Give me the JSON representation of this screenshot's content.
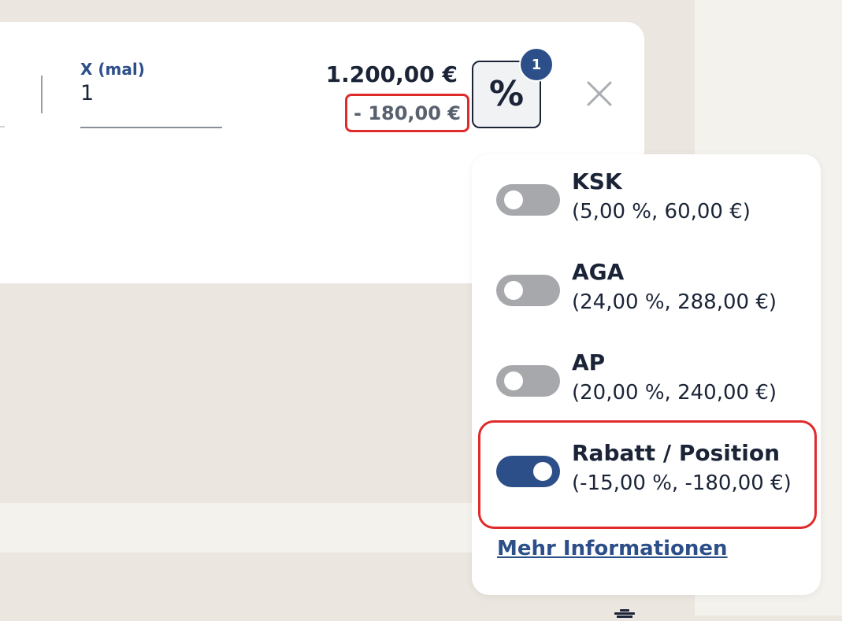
{
  "position_row": {
    "quantity_label": "X (mal)",
    "quantity_value": "1",
    "price": "1.200,00 €",
    "discount": "- 180,00 €",
    "percent_button_icon": "percent-icon",
    "percent_symbol": "%",
    "badge_count": "1",
    "close_icon": "close-icon"
  },
  "surcharge_popover": {
    "options": [
      {
        "title": "KSK",
        "detail": "(5,00 %, 60,00 €)",
        "enabled": false
      },
      {
        "title": "AGA",
        "detail": "(24,00 %, 288,00 €)",
        "enabled": false
      },
      {
        "title": "AP",
        "detail": "(20,00 %, 240,00 €)",
        "enabled": false
      },
      {
        "title": "Rabatt / Position",
        "detail": "(-15,00 %, -180,00 €)",
        "enabled": true
      }
    ],
    "more_info_link": "Mehr Informationen"
  },
  "colors": {
    "primary": "#2c4f89",
    "text": "#1b2437",
    "muted_text": "#58616d",
    "toggle_off": "#a7a8ab",
    "highlight": "#df2b2b",
    "page_bg": "#ebe6df"
  }
}
